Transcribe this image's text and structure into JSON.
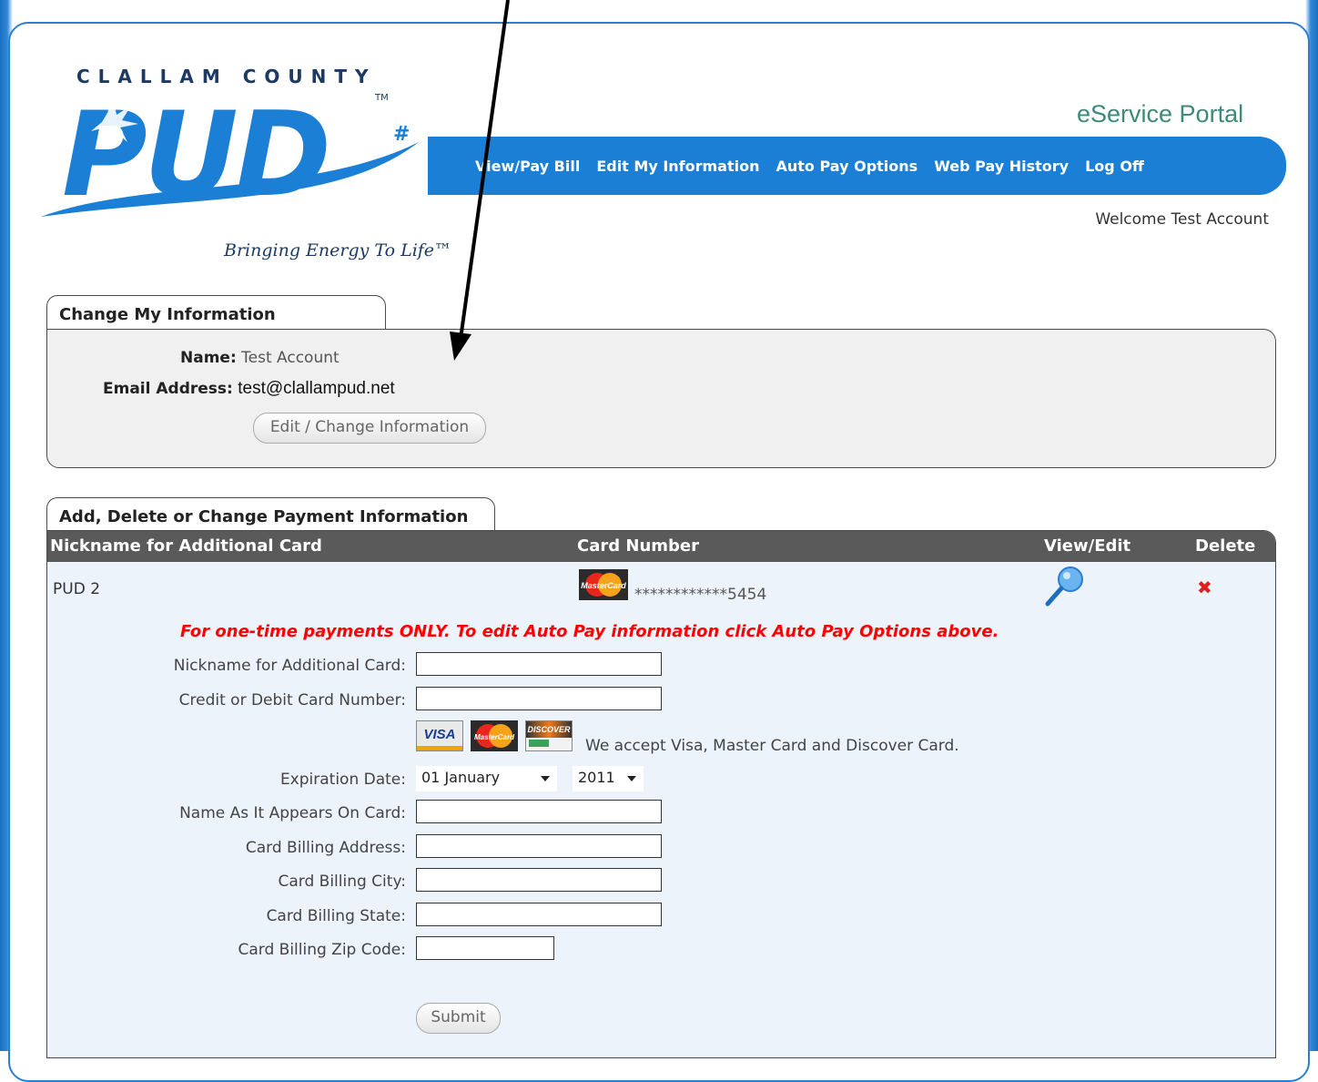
{
  "logo": {
    "county_text": "CLALLAM COUNTY",
    "brand_text": "PUD",
    "tagline": "Bringing Energy To Life™",
    "colors": {
      "blue": "#1b7fd5",
      "navy": "#1c3a63"
    }
  },
  "header": {
    "portal_title": "eService Portal",
    "nav": [
      {
        "label": "View/Pay Bill"
      },
      {
        "label": "Edit My Information"
      },
      {
        "label": "Auto Pay Options"
      },
      {
        "label": "Web Pay History"
      },
      {
        "label": "Log Off"
      }
    ],
    "welcome": "Welcome Test Account"
  },
  "info_section": {
    "tab_title": "Change My Information",
    "name_label": "Name:",
    "name_value": "Test Account",
    "email_label": "Email Address:",
    "email_value": "test@clallampud.net",
    "edit_button": "Edit / Change Information"
  },
  "payment_section": {
    "tab_title": "Add, Delete or Change Payment Information",
    "columns": [
      "Nickname for Additional Card",
      "Card Number",
      "View/Edit",
      "Delete"
    ],
    "rows": [
      {
        "nickname": "PUD 2",
        "card_brand": "MasterCard",
        "card_number": "************5454",
        "view_icon": "magnifier-icon",
        "delete_icon": "delete-x-icon"
      }
    ],
    "notice": "For one-time payments ONLY. To edit Auto Pay information click Auto Pay Options above.",
    "form": {
      "nickname_label": "Nickname for Additional Card:",
      "card_number_label": "Credit or Debit Card Number:",
      "accepted_cards": [
        {
          "name": "VISA"
        },
        {
          "name": "MasterCard"
        },
        {
          "name": "DISCOVER"
        }
      ],
      "accepted_text": "We accept Visa, Master Card and Discover Card.",
      "expiration_label": "Expiration Date:",
      "month_value": "01 January",
      "year_value": "2011",
      "name_on_card_label": "Name As It Appears On Card:",
      "address_label": "Card Billing Address:",
      "city_label": "Card Billing City:",
      "state_label": "Card Billing State:",
      "zip_label": "Card Billing Zip Code:",
      "submit_button": "Submit"
    }
  }
}
